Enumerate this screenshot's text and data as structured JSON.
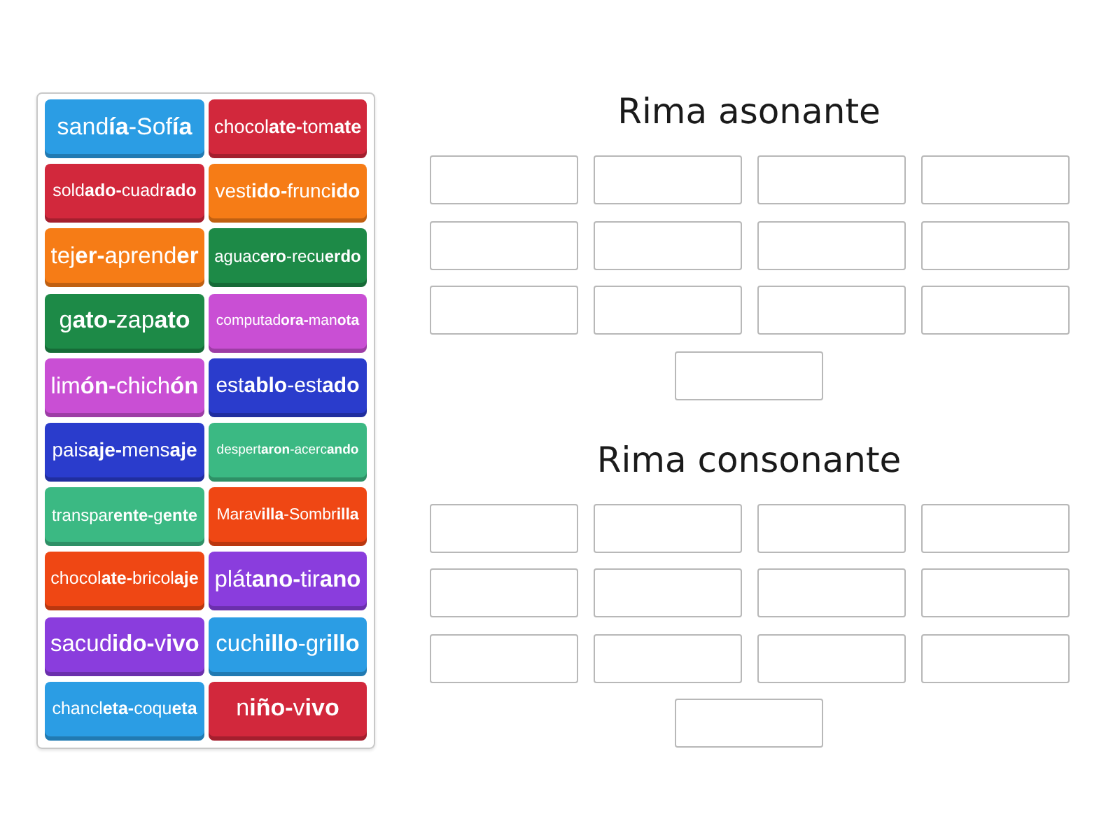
{
  "word_bank": {
    "tiles": [
      {
        "text": "sand**ía**-Sof**ía**",
        "color": "#2b9de4"
      },
      {
        "text": "chocol**ate-**tom**ate**",
        "color": "#d2283c"
      },
      {
        "text": "sold**ado-**cuadr**ado**",
        "color": "#d2283c"
      },
      {
        "text": "vest**ido-**frunc**ido**",
        "color": "#f67c16"
      },
      {
        "text": "tej**er-**aprend**er**",
        "color": "#f67c16"
      },
      {
        "text": "aguac**ero**-recu**erdo**",
        "color": "#1d8a47"
      },
      {
        "text": "g**ato-**zap**ato**",
        "color": "#1d8a47"
      },
      {
        "text": "computad**ora-**man**ota**",
        "color": "#c94fd4"
      },
      {
        "text": "lim**ón-**chich**ón**",
        "color": "#c94fd4"
      },
      {
        "text": "est**ablo**-est**ado**",
        "color": "#2a3ccc"
      },
      {
        "text": "pais**aje-**mens**aje**",
        "color": "#2a3ccc"
      },
      {
        "text": "despert**aron**-acerc**ando**",
        "color": "#3bb983"
      },
      {
        "text": "transpar**ente-**g**ente**",
        "color": "#3bb983"
      },
      {
        "text": "Marav**illa**-Sombr**illa**",
        "color": "#ef4714"
      },
      {
        "text": "chocol**ate-**bricol**aje**",
        "color": "#ef4714"
      },
      {
        "text": "plát**ano-**tir**ano**",
        "color": "#8a3ddd"
      },
      {
        "text": "sacud**ido-**v**ivo**",
        "color": "#8a3ddd"
      },
      {
        "text": "cuch**illo**-gr**illo**",
        "color": "#2b9de4"
      },
      {
        "text": "chancl**eta-**coqu**eta**",
        "color": "#2b9de4"
      },
      {
        "text": "n**iño-**v**ivo**",
        "color": "#d2283c"
      }
    ]
  },
  "groups": [
    {
      "title": "Rima asonante",
      "slots": [
        {
          "kind": "drop-zone"
        },
        {
          "kind": "drop-zone"
        },
        {
          "kind": "drop-zone"
        },
        {
          "kind": "drop-zone"
        },
        {
          "kind": "drop-zone"
        },
        {
          "kind": "drop-zone"
        },
        {
          "kind": "drop-zone"
        },
        {
          "kind": "drop-zone"
        },
        {
          "kind": "drop-zone"
        },
        {
          "kind": "drop-zone"
        },
        {
          "kind": "drop-zone"
        },
        {
          "kind": "drop-zone"
        },
        {
          "kind": "drop-zone"
        }
      ]
    },
    {
      "title": "Rima consonante",
      "slots": [
        {
          "kind": "drop-zone"
        },
        {
          "kind": "drop-zone"
        },
        {
          "kind": "drop-zone"
        },
        {
          "kind": "drop-zone"
        },
        {
          "kind": "drop-zone"
        },
        {
          "kind": "drop-zone"
        },
        {
          "kind": "drop-zone"
        },
        {
          "kind": "drop-zone"
        },
        {
          "kind": "drop-zone"
        },
        {
          "kind": "drop-zone"
        },
        {
          "kind": "drop-zone"
        },
        {
          "kind": "drop-zone"
        },
        {
          "kind": "drop-zone"
        }
      ]
    }
  ]
}
